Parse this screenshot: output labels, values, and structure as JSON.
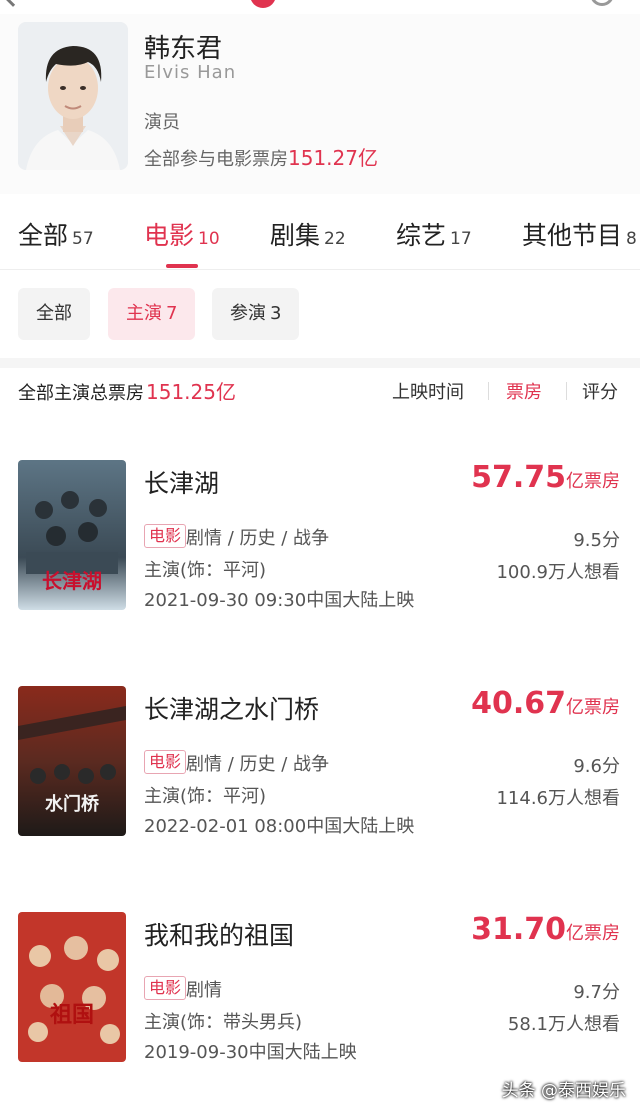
{
  "profile": {
    "name": "韩东君",
    "english_name": "Elvis Han",
    "role": "演员",
    "box_office_label": "全部参与电影票房",
    "box_office_total": "151.27亿"
  },
  "tabs": [
    {
      "label": "全部",
      "count": "57"
    },
    {
      "label": "电影",
      "count": "10"
    },
    {
      "label": "剧集",
      "count": "22"
    },
    {
      "label": "综艺",
      "count": "17"
    },
    {
      "label": "其他节目",
      "count": "8"
    }
  ],
  "filters": [
    {
      "label": "全部",
      "count": ""
    },
    {
      "label": "主演",
      "count": "7"
    },
    {
      "label": "参演",
      "count": "3"
    }
  ],
  "summary": {
    "label": "全部主演总票房",
    "amount": "151.25亿"
  },
  "sort": {
    "release_time": "上映时间",
    "box_office": "票房",
    "rating": "评分"
  },
  "movies": [
    {
      "title": "长津湖",
      "box_office": "57.75",
      "box_unit": "亿票房",
      "tag": "电影",
      "genres": "剧情 / 历史 / 战争",
      "role": "主演(饰：平河)",
      "release": "2021-09-30 09:30中国大陆上映",
      "score": "9.5分",
      "want": "100.9万人想看",
      "poster_text": "长津湖"
    },
    {
      "title": "长津湖之水门桥",
      "box_office": "40.67",
      "box_unit": "亿票房",
      "tag": "电影",
      "genres": "剧情 / 历史 / 战争",
      "role": "主演(饰：平河)",
      "release": "2022-02-01 08:00中国大陆上映",
      "score": "9.6分",
      "want": "114.6万人想看",
      "poster_text": "水门桥"
    },
    {
      "title": "我和我的祖国",
      "box_office": "31.70",
      "box_unit": "亿票房",
      "tag": "电影",
      "genres": "剧情",
      "role": "主演(饰：带头男兵)",
      "release": "2019-09-30中国大陆上映",
      "score": "9.7分",
      "want": "58.1万人想看",
      "poster_text": "祖国"
    }
  ],
  "watermark": "头条 @泰西娱乐",
  "colors": {
    "accent": "#e0334f",
    "chip_active_bg": "#fce8ec",
    "chip_bg": "#f3f3f3"
  }
}
